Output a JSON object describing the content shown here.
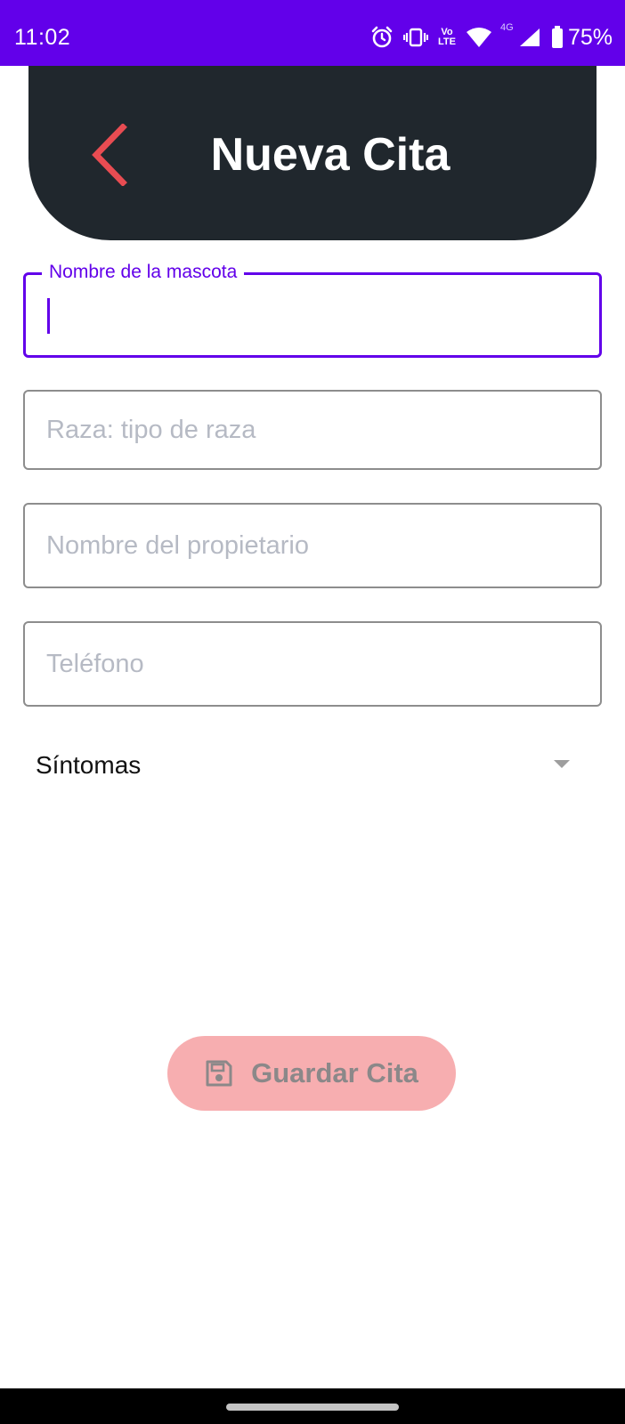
{
  "status_bar": {
    "time": "11:02",
    "volte_top": "Vo",
    "volte_bottom": "LTE",
    "network": "4G",
    "battery": "75%"
  },
  "header": {
    "title": "Nueva Cita",
    "back_icon": "chevron-left-icon"
  },
  "form": {
    "pet_name": {
      "label": "Nombre de la mascota",
      "value": "",
      "placeholder": ""
    },
    "breed": {
      "value": "",
      "placeholder": "Raza: tipo de raza"
    },
    "owner": {
      "value": "",
      "placeholder": "Nombre del propietario"
    },
    "phone": {
      "value": "",
      "placeholder": "Teléfono"
    },
    "symptoms": {
      "selected": "Síntomas"
    }
  },
  "actions": {
    "save_label": "Guardar Cita",
    "save_icon": "save-icon"
  },
  "colors": {
    "status_bar": "#6200ea",
    "header_bg": "#20272d",
    "back_icon": "#e84c52",
    "focus": "#6200ea",
    "save_button_bg": "#f7aeb0"
  }
}
